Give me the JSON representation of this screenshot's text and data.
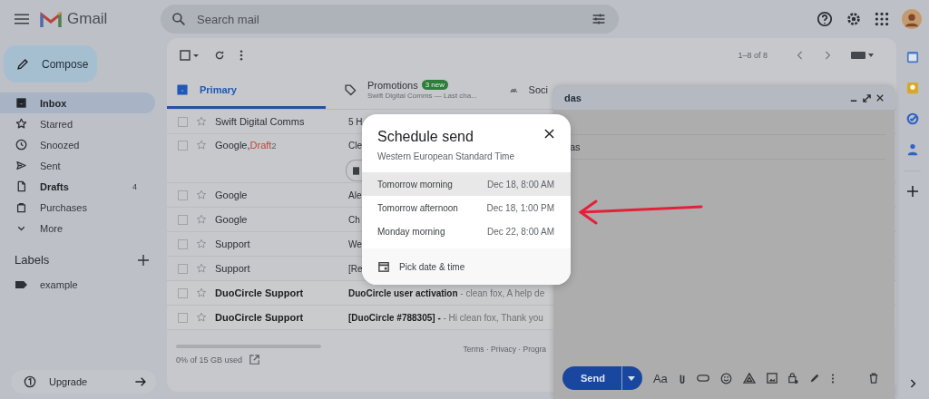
{
  "header": {
    "app_name": "Gmail",
    "search": {
      "placeholder": "Search mail"
    }
  },
  "sidebar": {
    "compose": "Compose",
    "items": [
      {
        "label": "Inbox",
        "selected": true,
        "bold": true
      },
      {
        "label": "Starred",
        "selected": false,
        "bold": false
      },
      {
        "label": "Snoozed",
        "selected": false,
        "bold": false
      },
      {
        "label": "Sent",
        "selected": false,
        "bold": false
      },
      {
        "label": "Drafts",
        "selected": false,
        "bold": true,
        "count": "4"
      },
      {
        "label": "Purchases",
        "selected": false,
        "bold": false
      },
      {
        "label": "More",
        "selected": false,
        "bold": false
      }
    ],
    "labels_title": "Labels",
    "labels": [
      {
        "label": "example"
      }
    ],
    "upgrade": "Upgrade"
  },
  "toolbar": {
    "pagination": "1–8 of 8"
  },
  "tabs": [
    {
      "label": "Primary",
      "selected": true
    },
    {
      "label": "Promotions",
      "selected": false,
      "badge": "3 new",
      "subtitle": "Swift Digital Comms — Last cha..."
    },
    {
      "label": "Soci",
      "selected": false
    }
  ],
  "rows": [
    {
      "sender": "Swift Digital Comms",
      "subject": "5 H",
      "unread": false,
      "checked": false
    },
    {
      "sender": "Google,",
      "draft": "Draft",
      "count": "2",
      "subject": "Cle",
      "unread": false,
      "checked": false,
      "attachment": true
    },
    {
      "sender": "Google",
      "subject": "Ale",
      "unread": false,
      "checked": false
    },
    {
      "sender": "Google",
      "subject": "Ch",
      "unread": false,
      "checked": false
    },
    {
      "sender": "Support",
      "subject": "We",
      "unread": false,
      "checked": false
    },
    {
      "sender": "Support",
      "subject": "[Re",
      "unread": false,
      "checked": false
    },
    {
      "sender": "DuoCircle Support",
      "subject": "DuoCircle user activation",
      "snippet": " - clean fox, A help de",
      "unread": true,
      "checked": false
    },
    {
      "sender": "DuoCircle Support",
      "subject": "[DuoCircle #788305] -",
      "snippet": " - Hi clean fox, Thank you",
      "unread": true,
      "checked": false
    }
  ],
  "storage": {
    "text": "0% of 15 GB used",
    "level": 0
  },
  "footer_links": "Terms · Privacy · Progra",
  "compose_window": {
    "title": "das",
    "subject": "as",
    "send": "Send",
    "format": "Aa"
  },
  "schedule_dialog": {
    "title": "Schedule send",
    "timezone": "Western European Standard Time",
    "options": [
      {
        "label": "Tomorrow morning",
        "time": "Dec 18, 8:00 AM",
        "selected": true
      },
      {
        "label": "Tomorrow afternoon",
        "time": "Dec 18, 1:00 PM",
        "selected": false
      },
      {
        "label": "Monday morning",
        "time": "Dec 22, 8:00 AM",
        "selected": false
      }
    ],
    "custom": "Pick date & time"
  }
}
